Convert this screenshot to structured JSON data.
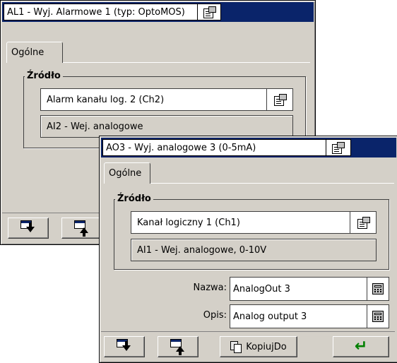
{
  "window_back": {
    "title": "AL1 - Wyj. Alarmowe 1 (typ: OptoMOS)",
    "tab_label": "Ogólne",
    "group_label": "Źródło",
    "source_field_value": "Alarm kanału log. 2 (Ch2)",
    "info_field_value": "AI2 - Wej. analogowe"
  },
  "window_front": {
    "title": "AO3 - Wyj. analogowe 3 (0-5mA)",
    "tab_label": "Ogólne",
    "group_label": "Źródło",
    "source_field_value": "Kanał logiczny 1 (Ch1)",
    "info_field_value": "AI1 - Wej. analogowe, 0-10V",
    "name_label": "Nazwa:",
    "name_value": "AnalogOut 3",
    "desc_label": "Opis:",
    "desc_value": "Analog output 3",
    "copy_button_label": "KopiujDo"
  },
  "colors": {
    "title_bar": "#0a246a",
    "window_face": "#d4d0c8",
    "enter_arrow": "#008000"
  },
  "icons": [
    "properties-icon",
    "calculator-icon",
    "arrow-down-icon",
    "arrow-up-icon",
    "copy-icon",
    "enter-icon"
  ]
}
